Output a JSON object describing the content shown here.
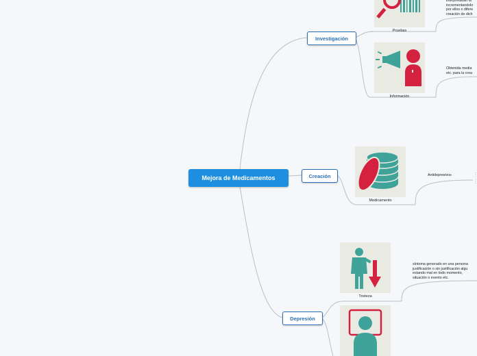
{
  "root": {
    "label": "Mejora de Medicamentos"
  },
  "branches": [
    {
      "label": "Investigación"
    },
    {
      "label": "Creación"
    },
    {
      "label": "Depresión"
    }
  ],
  "topics": {
    "pruebas": {
      "caption": "Pruebas",
      "icon": "magnifier-barcode-icon"
    },
    "informacion": {
      "caption": "Información",
      "icon": "megaphone-person-icon"
    },
    "medicamento": {
      "caption": "Medicamento",
      "icon": "pill-stack-icon"
    },
    "tristeza": {
      "caption": "Tristeza",
      "icon": "person-down-arrow-icon"
    },
    "person_screen": {
      "icon": "person-screen-icon"
    }
  },
  "notes": {
    "pruebas": "interpretadan la\nincrementandolo\npor ellos o difere\ncreación de dich",
    "informacion": "Obtenida media\netc. para la crea",
    "antidepresivos": "Antidepresivos",
    "tristeza": "síntoma generado en una persona\njustificación o sin justificación algu\nestando mal en todo momento,\nsituación o evento etc."
  },
  "colors": {
    "root_fill": "#1e8fe0",
    "branch_border": "#2a6fb5",
    "connector": "#b9bec6",
    "teal": "#3fa39a",
    "red": "#d3213f",
    "image_bg": "#e9ebe3"
  }
}
